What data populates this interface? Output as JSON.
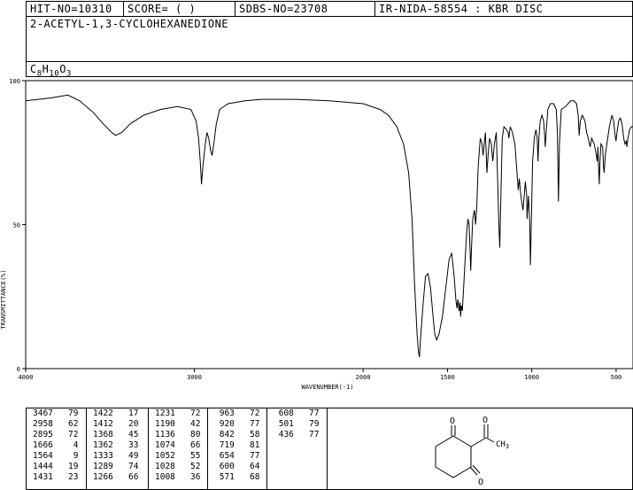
{
  "header": {
    "hit_no": "HIT-NO=10310",
    "score": "SCORE=  (   )",
    "sdbs_no": "SDBS-NO=23708",
    "ir_info": "IR-NIDA-58554 : KBR DISC",
    "compound_name": "2-ACETYL-1,3-CYCLOHEXANEDIONE",
    "formula": "C8H10O3"
  },
  "chart_data": {
    "type": "line",
    "xlabel": "WAVENUMBER(-1)",
    "ylabel": "TRANSMITTANCE(%)",
    "xlim": [
      4000,
      400
    ],
    "ylim": [
      0,
      100
    ],
    "x_ticks": [
      4000,
      3000,
      2000,
      1500,
      1000,
      500
    ],
    "y_ticks": [
      0,
      50,
      100
    ],
    "grid": false,
    "series": [
      {
        "points": [
          [
            4000,
            93
          ],
          [
            3850,
            94
          ],
          [
            3750,
            95
          ],
          [
            3680,
            93
          ],
          [
            3600,
            89
          ],
          [
            3540,
            85
          ],
          [
            3490,
            82
          ],
          [
            3467,
            81
          ],
          [
            3430,
            82
          ],
          [
            3380,
            85
          ],
          [
            3300,
            88
          ],
          [
            3200,
            90
          ],
          [
            3100,
            91
          ],
          [
            3020,
            90
          ],
          [
            2990,
            86
          ],
          [
            2975,
            80
          ],
          [
            2965,
            72
          ],
          [
            2958,
            64
          ],
          [
            2950,
            70
          ],
          [
            2935,
            78
          ],
          [
            2925,
            82
          ],
          [
            2915,
            80
          ],
          [
            2905,
            76
          ],
          [
            2895,
            74
          ],
          [
            2885,
            78
          ],
          [
            2870,
            85
          ],
          [
            2850,
            90
          ],
          [
            2800,
            92
          ],
          [
            2700,
            93
          ],
          [
            2600,
            93.5
          ],
          [
            2400,
            93.5
          ],
          [
            2200,
            93
          ],
          [
            2000,
            92
          ],
          [
            1900,
            90
          ],
          [
            1850,
            88
          ],
          [
            1800,
            84
          ],
          [
            1760,
            78
          ],
          [
            1730,
            68
          ],
          [
            1710,
            52
          ],
          [
            1695,
            30
          ],
          [
            1680,
            12
          ],
          [
            1672,
            6
          ],
          [
            1666,
            4
          ],
          [
            1660,
            10
          ],
          [
            1645,
            22
          ],
          [
            1630,
            32
          ],
          [
            1615,
            33
          ],
          [
            1600,
            28
          ],
          [
            1585,
            18
          ],
          [
            1575,
            12
          ],
          [
            1564,
            10
          ],
          [
            1550,
            12
          ],
          [
            1530,
            18
          ],
          [
            1510,
            28
          ],
          [
            1490,
            38
          ],
          [
            1475,
            40
          ],
          [
            1460,
            32
          ],
          [
            1450,
            24
          ],
          [
            1444,
            21
          ],
          [
            1438,
            24
          ],
          [
            1431,
            20
          ],
          [
            1426,
            23
          ],
          [
            1422,
            18
          ],
          [
            1418,
            22
          ],
          [
            1412,
            20
          ],
          [
            1405,
            27
          ],
          [
            1395,
            38
          ],
          [
            1385,
            48
          ],
          [
            1378,
            52
          ],
          [
            1372,
            50
          ],
          [
            1368,
            45
          ],
          [
            1365,
            40
          ],
          [
            1362,
            34
          ],
          [
            1357,
            42
          ],
          [
            1350,
            52
          ],
          [
            1340,
            55
          ],
          [
            1333,
            50
          ],
          [
            1326,
            56
          ],
          [
            1318,
            70
          ],
          [
            1305,
            80
          ],
          [
            1295,
            78
          ],
          [
            1289,
            74
          ],
          [
            1282,
            78
          ],
          [
            1275,
            82
          ],
          [
            1266,
            68
          ],
          [
            1258,
            75
          ],
          [
            1250,
            80
          ],
          [
            1240,
            78
          ],
          [
            1231,
            72
          ],
          [
            1222,
            78
          ],
          [
            1210,
            82
          ],
          [
            1200,
            60
          ],
          [
            1195,
            50
          ],
          [
            1190,
            42
          ],
          [
            1185,
            55
          ],
          [
            1175,
            80
          ],
          [
            1165,
            84
          ],
          [
            1150,
            83
          ],
          [
            1140,
            82
          ],
          [
            1136,
            80
          ],
          [
            1128,
            84
          ],
          [
            1115,
            82
          ],
          [
            1100,
            78
          ],
          [
            1090,
            70
          ],
          [
            1080,
            62
          ],
          [
            1074,
            66
          ],
          [
            1068,
            62
          ],
          [
            1060,
            58
          ],
          [
            1052,
            55
          ],
          [
            1045,
            60
          ],
          [
            1038,
            65
          ],
          [
            1030,
            60
          ],
          [
            1028,
            52
          ],
          [
            1020,
            60
          ],
          [
            1012,
            50
          ],
          [
            1008,
            36
          ],
          [
            1003,
            50
          ],
          [
            995,
            72
          ],
          [
            985,
            80
          ],
          [
            975,
            83
          ],
          [
            968,
            80
          ],
          [
            963,
            72
          ],
          [
            958,
            80
          ],
          [
            950,
            86
          ],
          [
            940,
            88
          ],
          [
            930,
            86
          ],
          [
            925,
            82
          ],
          [
            920,
            77
          ],
          [
            915,
            82
          ],
          [
            905,
            90
          ],
          [
            890,
            92
          ],
          [
            870,
            92
          ],
          [
            855,
            90
          ],
          [
            848,
            82
          ],
          [
            842,
            58
          ],
          [
            836,
            78
          ],
          [
            825,
            90
          ],
          [
            800,
            91
          ],
          [
            770,
            93
          ],
          [
            750,
            93
          ],
          [
            735,
            92
          ],
          [
            725,
            88
          ],
          [
            719,
            81
          ],
          [
            712,
            86
          ],
          [
            700,
            88
          ],
          [
            685,
            86
          ],
          [
            675,
            82
          ],
          [
            665,
            80
          ],
          [
            658,
            78
          ],
          [
            654,
            77
          ],
          [
            645,
            80
          ],
          [
            630,
            78
          ],
          [
            620,
            75
          ],
          [
            612,
            72
          ],
          [
            608,
            77
          ],
          [
            604,
            70
          ],
          [
            600,
            64
          ],
          [
            596,
            72
          ],
          [
            590,
            78
          ],
          [
            580,
            77
          ],
          [
            575,
            70
          ],
          [
            571,
            68
          ],
          [
            565,
            74
          ],
          [
            555,
            78
          ],
          [
            540,
            84
          ],
          [
            525,
            88
          ],
          [
            515,
            86
          ],
          [
            508,
            82
          ],
          [
            501,
            79
          ],
          [
            495,
            82
          ],
          [
            485,
            86
          ],
          [
            475,
            87
          ],
          [
            465,
            85
          ],
          [
            455,
            80
          ],
          [
            448,
            78
          ],
          [
            440,
            79
          ],
          [
            436,
            77
          ],
          [
            430,
            80
          ],
          [
            420,
            83
          ],
          [
            410,
            84
          ],
          [
            400,
            84
          ]
        ]
      }
    ],
    "peak_table": [
      [
        [
          "3467",
          "79"
        ],
        [
          "2958",
          "62"
        ],
        [
          "2895",
          "72"
        ],
        [
          "1666",
          "4"
        ],
        [
          "1564",
          "9"
        ],
        [
          "1444",
          "19"
        ],
        [
          "1431",
          "23"
        ]
      ],
      [
        [
          "1422",
          "17"
        ],
        [
          "1412",
          "20"
        ],
        [
          "1368",
          "45"
        ],
        [
          "1362",
          "33"
        ],
        [
          "1333",
          "49"
        ],
        [
          "1289",
          "74"
        ],
        [
          "1266",
          "66"
        ]
      ],
      [
        [
          "1231",
          "72"
        ],
        [
          "1190",
          "42"
        ],
        [
          "1136",
          "80"
        ],
        [
          "1074",
          "66"
        ],
        [
          "1052",
          "55"
        ],
        [
          "1028",
          "52"
        ],
        [
          "1008",
          "36"
        ]
      ],
      [
        [
          "963",
          "72"
        ],
        [
          "920",
          "77"
        ],
        [
          "842",
          "58"
        ],
        [
          "719",
          "81"
        ],
        [
          "654",
          "77"
        ],
        [
          "600",
          "64"
        ],
        [
          "571",
          "68"
        ]
      ],
      [
        [
          "608",
          "77"
        ],
        [
          "501",
          "79"
        ],
        [
          "436",
          "77"
        ]
      ]
    ]
  },
  "structure": {
    "ch3_label": "CH3"
  }
}
